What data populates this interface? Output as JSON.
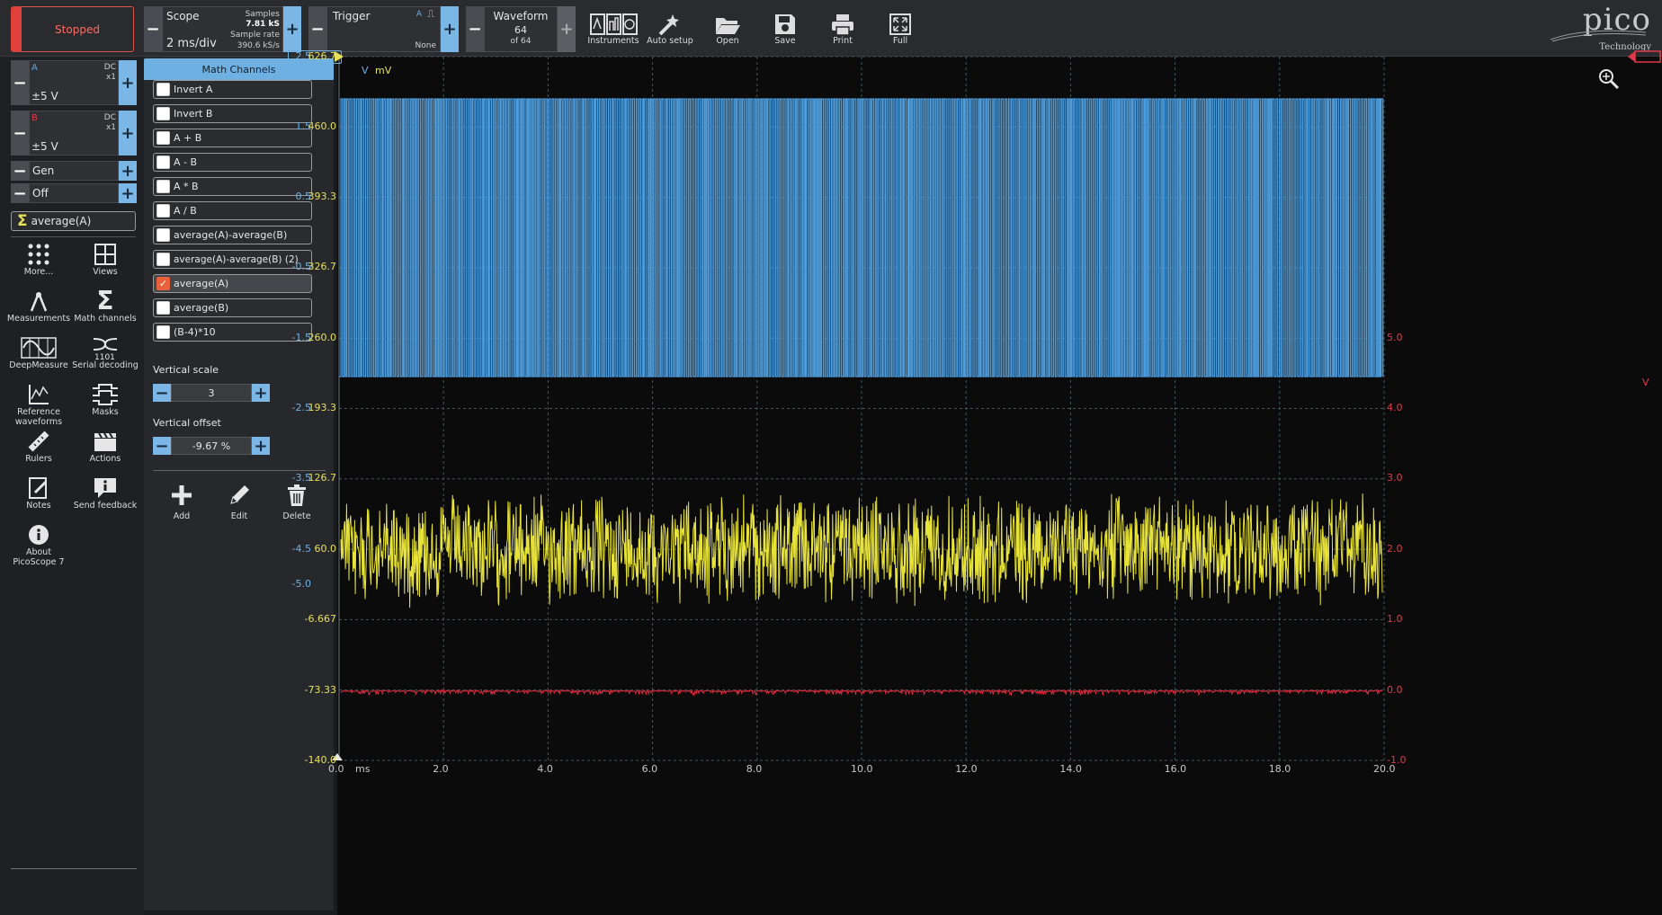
{
  "toolbar": {
    "status_label": "Stopped",
    "scope": {
      "title": "Scope",
      "timebase": "2 ms/div",
      "samples_label": "Samples",
      "samples_value": "7.81 kS",
      "rate_label": "Sample rate",
      "rate_value": "390.6 kS/s"
    },
    "trigger": {
      "title": "Trigger",
      "channel": "A",
      "mode": "None"
    },
    "waveform": {
      "title": "Waveform",
      "current": "64",
      "of_total": "of 64"
    },
    "tools": [
      {
        "label": "Instruments",
        "icon": "instruments-icon"
      },
      {
        "label": "Auto setup",
        "icon": "auto-setup-icon"
      },
      {
        "label": "Open",
        "icon": "folder-open-icon"
      },
      {
        "label": "Save",
        "icon": "save-icon"
      },
      {
        "label": "Print",
        "icon": "print-icon"
      },
      {
        "label": "Full",
        "icon": "fullscreen-icon"
      }
    ],
    "logo_text": "pico",
    "logo_sub": "Technology"
  },
  "channels": [
    {
      "name": "A",
      "coupling": "DC",
      "probe": "x1",
      "range": "±5 V",
      "color": "#5aa5e6"
    },
    {
      "name": "B",
      "coupling": "DC",
      "probe": "x1",
      "range": "±5 V",
      "color": "#e03a4a"
    }
  ],
  "generator": {
    "label": "Gen",
    "state": "Off"
  },
  "active_math": "average(A)",
  "side_buttons": [
    {
      "label": "More...",
      "icon": "more-dots-icon"
    },
    {
      "label": "Views",
      "icon": "views-grid-icon"
    },
    {
      "label": "Measurements",
      "icon": "measurements-icon"
    },
    {
      "label": "Math channels",
      "icon": "sigma-icon"
    },
    {
      "label": "DeepMeasure",
      "icon": "deepmeasure-icon"
    },
    {
      "label": "Serial decoding",
      "icon": "serial-decoding-icon"
    },
    {
      "label": "Reference waveforms",
      "icon": "reference-waveforms-icon"
    },
    {
      "label": "Masks",
      "icon": "masks-icon"
    },
    {
      "label": "Rulers",
      "icon": "ruler-icon"
    },
    {
      "label": "Actions",
      "icon": "actions-clapper-icon"
    },
    {
      "label": "Notes",
      "icon": "notes-icon"
    },
    {
      "label": "Send feedback",
      "icon": "feedback-icon"
    },
    {
      "label": "About PicoScope 7",
      "icon": "info-icon"
    }
  ],
  "math_panel": {
    "title": "Math Channels",
    "items": [
      {
        "label": "Invert A",
        "checked": false
      },
      {
        "label": "Invert B",
        "checked": false
      },
      {
        "label": "A + B",
        "checked": false
      },
      {
        "label": "A - B",
        "checked": false
      },
      {
        "label": "A * B",
        "checked": false
      },
      {
        "label": "A / B",
        "checked": false
      },
      {
        "label": "average(A)-average(B)",
        "checked": false
      },
      {
        "label": "average(A)-average(B) (2)",
        "checked": false
      },
      {
        "label": "average(A)",
        "checked": true
      },
      {
        "label": "average(B)",
        "checked": false
      },
      {
        "label": "(B-4)*10",
        "checked": false
      }
    ],
    "vertical_scale_label": "Vertical scale",
    "vertical_scale_value": "3",
    "vertical_offset_label": "Vertical offset",
    "vertical_offset_value": "-9.67 %",
    "actions": [
      {
        "label": "Add",
        "icon": "plus-icon"
      },
      {
        "label": "Edit",
        "icon": "pencil-icon"
      },
      {
        "label": "Delete",
        "icon": "trash-icon"
      }
    ]
  },
  "plot": {
    "blue_unit": "V",
    "yellow_unit": "mV",
    "red_unit": "V",
    "blue_axis": [
      "2.5",
      "1.5",
      "0.5",
      "-0.5",
      "-1.5",
      "-2.5",
      "-3.5",
      "-4.5",
      "-5.0"
    ],
    "yellow_axis": [
      "626.7",
      "460.0",
      "393.3",
      "326.7",
      "260.0",
      "193.3",
      "126.7",
      "60.0",
      "-6.667",
      "-73.33",
      "-140.0"
    ],
    "red_axis": [
      "5.0",
      "4.0",
      "3.0",
      "2.0",
      "1.0",
      "0.0",
      "-1.0"
    ],
    "x_axis": [
      "0.0",
      "2.0",
      "4.0",
      "6.0",
      "8.0",
      "10.0",
      "12.0",
      "14.0",
      "16.0",
      "18.0",
      "20.0"
    ],
    "x_unit": "ms",
    "colors": {
      "blue": "#4f9ee0",
      "yellow": "#e8e33a",
      "red": "#e0283c",
      "grid": "#3c5a5e"
    }
  }
}
